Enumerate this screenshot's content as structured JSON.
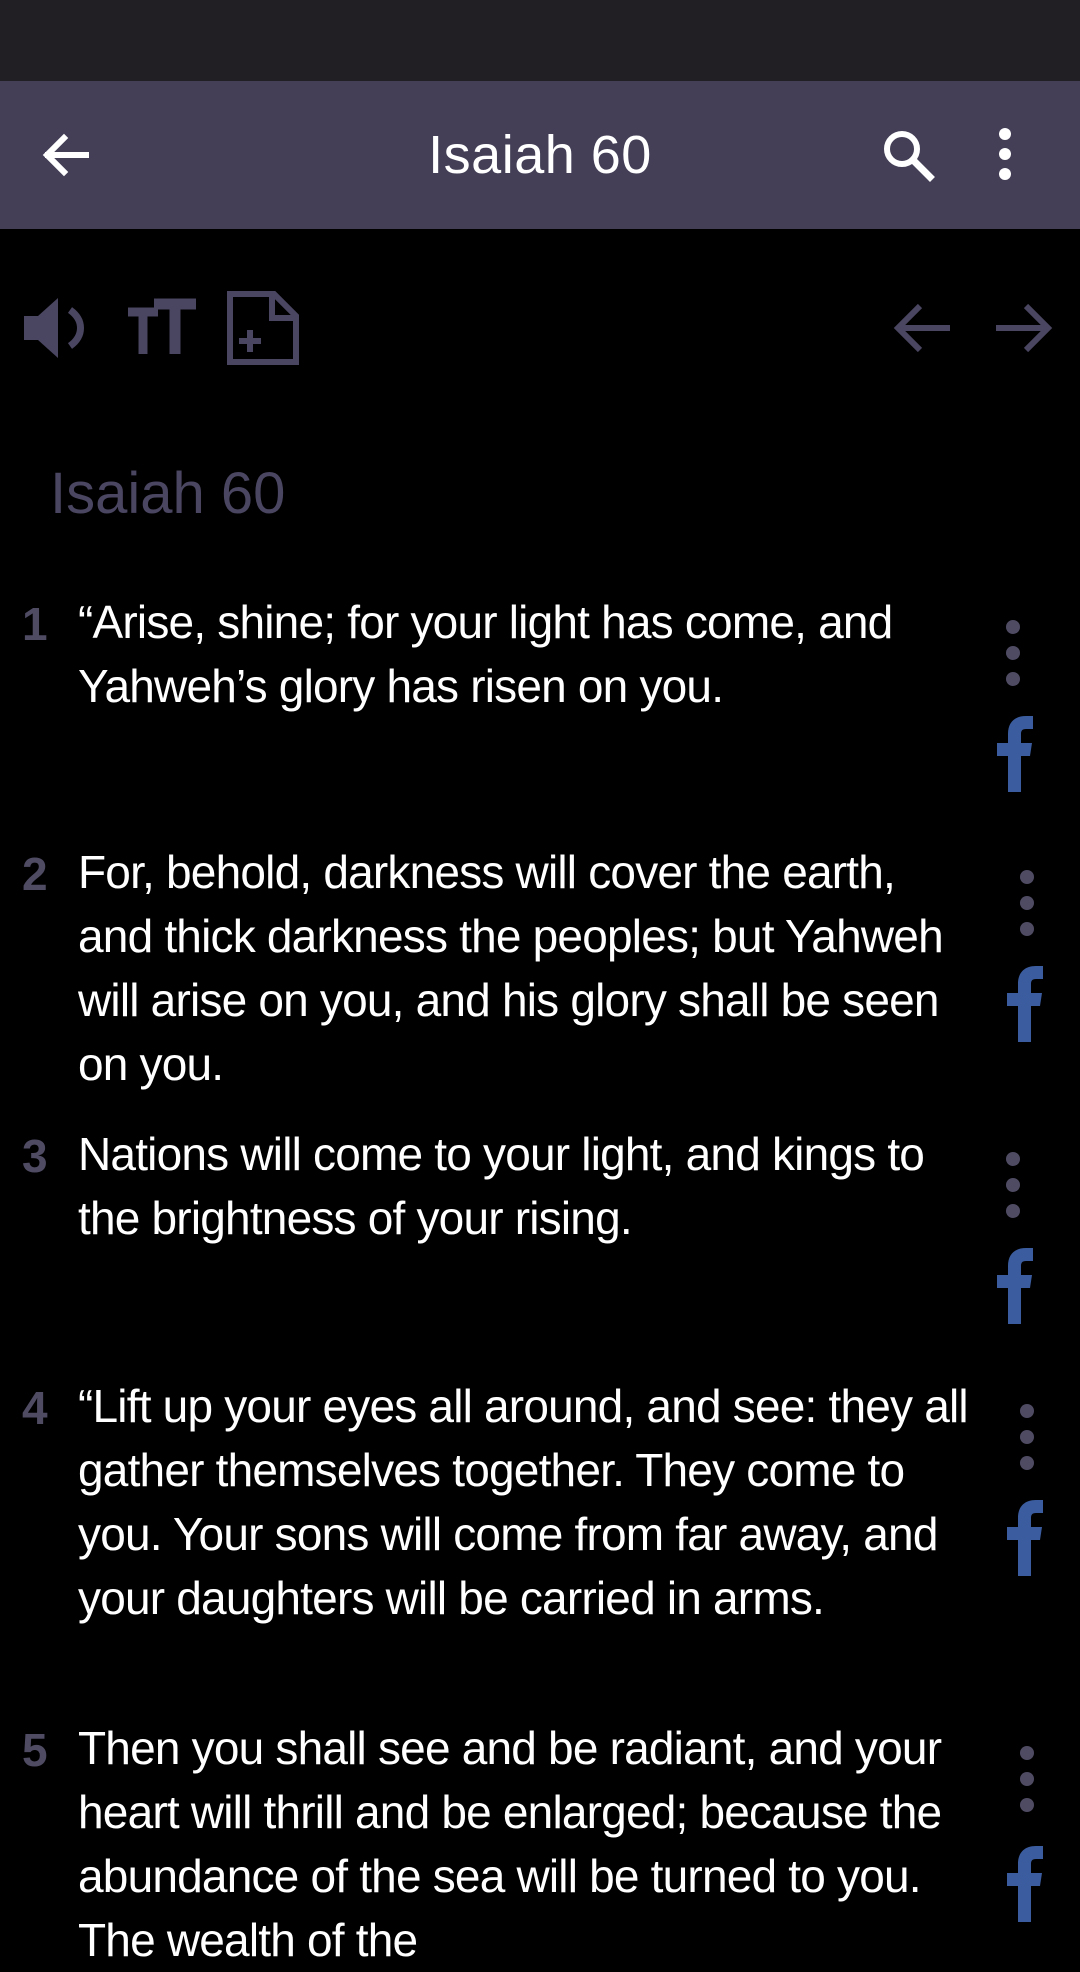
{
  "app_bar": {
    "title": "Isaiah 60"
  },
  "icons": {
    "back": "arrow-left-icon",
    "search": "search-icon",
    "more": "more-vertical-icon",
    "audio": "speaker-icon",
    "text_size": "text-size-icon",
    "add_note": "note-add-icon",
    "prev": "arrow-left-icon",
    "next": "arrow-right-icon",
    "verse_menu": "more-vertical-icon",
    "share": "facebook-icon"
  },
  "colors": {
    "status_bar": "#221f24",
    "app_bar": "#443f57",
    "background": "#000000",
    "muted": "#4f4b63",
    "facebook": "#3b5c9e"
  },
  "content": {
    "chapter_heading": "Isaiah 60",
    "verses": [
      {
        "num": "1",
        "text": "“Arise, shine; for your light has come, and Yahweh’s glory has risen on you."
      },
      {
        "num": "2",
        "text": "For, behold, darkness will cover the earth, and thick darkness the peoples; but Yahweh will arise on you, and his glory shall be seen on you."
      },
      {
        "num": "3",
        "text": "Nations will come to your light, and kings to the brightness of your rising."
      },
      {
        "num": "4",
        "text": "“Lift up your eyes all around, and see: they all gather themselves together. They come to you. Your sons will come from far away, and your daughters will be carried in arms."
      },
      {
        "num": "5",
        "text": "Then you shall see and be radiant, and your heart will thrill and be enlarged; because the abundance of the sea will be turned to you. The wealth of the"
      }
    ]
  }
}
